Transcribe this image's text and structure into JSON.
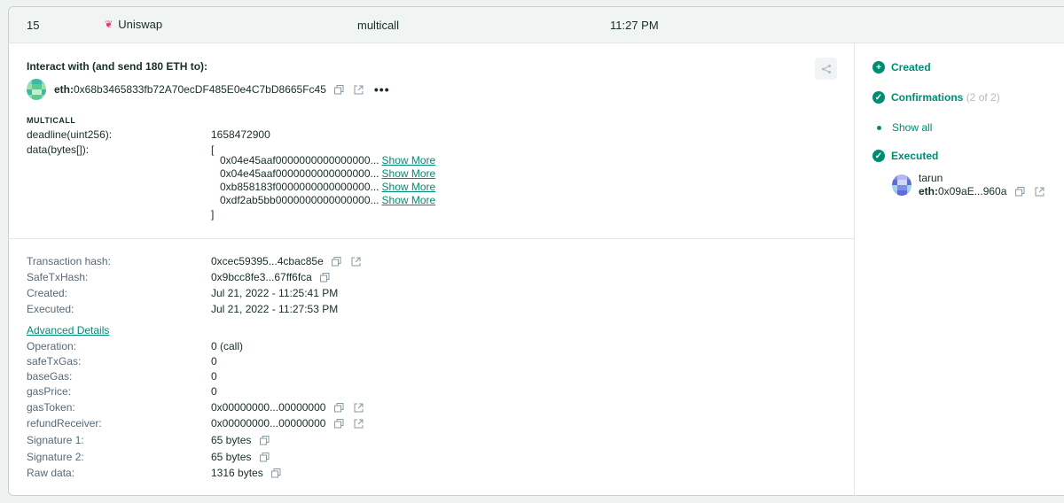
{
  "row": {
    "nonce": "15",
    "app_name": "Uniswap",
    "app_icon": "uniswap-unicorn-icon",
    "method": "multicall",
    "time": "11:27 PM"
  },
  "interact": {
    "title": "Interact with (and send 180 ETH to):",
    "prefix": "eth:",
    "address": "0x68b3465833fb72A70ecDF485E0e4C7bD8665Fc45"
  },
  "multicall": {
    "label": "MULTICALL",
    "params": [
      {
        "name": "deadline(uint256):",
        "value": "1658472900"
      },
      {
        "name": "data(bytes[]):",
        "value": ""
      }
    ],
    "open_bracket": "[",
    "close_bracket": "]",
    "data_items": [
      {
        "hex": "0x04e45aaf0000000000000000...",
        "link": "Show More"
      },
      {
        "hex": "0x04e45aaf0000000000000000...",
        "link": "Show More"
      },
      {
        "hex": "0xb858183f0000000000000000...",
        "link": "Show More"
      },
      {
        "hex": "0xdf2ab5bb0000000000000000...",
        "link": "Show More"
      }
    ]
  },
  "details": {
    "tx_hash_label": "Transaction hash:",
    "tx_hash": "0xcec59395...4cbac85e",
    "safe_tx_hash_label": "SafeTxHash:",
    "safe_tx_hash": "0x9bcc8fe3...67ff6fca",
    "created_label": "Created:",
    "created": "Jul 21, 2022 - 11:25:41 PM",
    "executed_label": "Executed:",
    "executed": "Jul 21, 2022 - 11:27:53 PM",
    "advanced_link": "Advanced Details",
    "operation_label": "Operation:",
    "operation": "0 (call)",
    "safe_tx_gas_label": "safeTxGas:",
    "safe_tx_gas": "0",
    "base_gas_label": "baseGas:",
    "base_gas": "0",
    "gas_price_label": "gasPrice:",
    "gas_price": "0",
    "gas_token_label": "gasToken:",
    "gas_token": "0x00000000...00000000",
    "refund_receiver_label": "refundReceiver:",
    "refund_receiver": "0x00000000...00000000",
    "sig1_label": "Signature 1:",
    "sig1": "65 bytes",
    "sig2_label": "Signature 2:",
    "sig2": "65 bytes",
    "raw_label": "Raw data:",
    "raw": "1316 bytes"
  },
  "timeline": {
    "created": "Created",
    "confirmations": "Confirmations",
    "confirmations_count": "(2 of 2)",
    "show_all": "Show all",
    "executed": "Executed",
    "owner_name": "tarun",
    "owner_prefix": "eth:",
    "owner_address": "0x09aE...960a"
  },
  "colors": {
    "accent": "#008c73",
    "border": "#b9d8d0",
    "uniswap_pink": "#e8327a"
  }
}
